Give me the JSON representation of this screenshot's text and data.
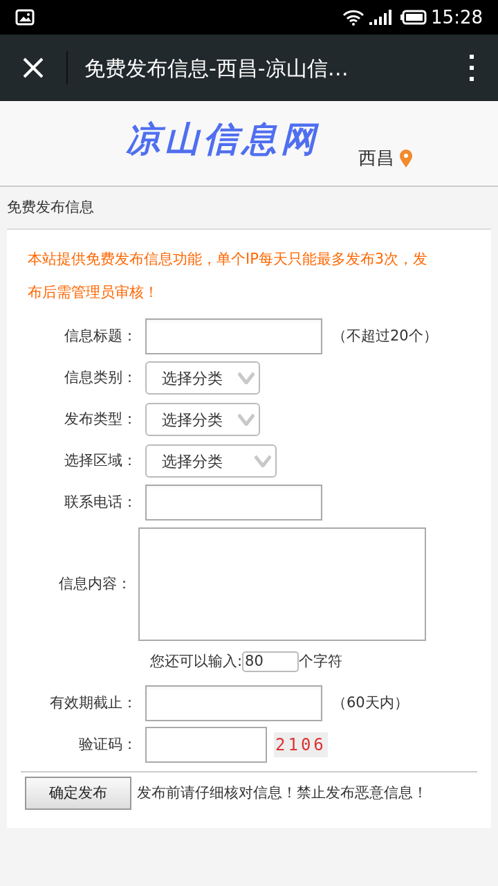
{
  "status_bar": {
    "time": "15:28"
  },
  "toolbar": {
    "title": "免费发布信息-西昌-凉山信…"
  },
  "header": {
    "logo": "凉山信息网",
    "city": "西昌"
  },
  "section_title": "免费发布信息",
  "notice": "本站提供免费发布信息功能，单个IP每天只能最多发布3次，发布后需管理员审核！",
  "fields": [
    {
      "kind": "text",
      "label": "信息标题：",
      "note": "（不超过20个）"
    },
    {
      "kind": "select",
      "label": "信息类别：",
      "value": "选择分类"
    },
    {
      "kind": "select",
      "label": "发布类型：",
      "value": "选择分类"
    },
    {
      "kind": "select",
      "label": "选择区域：",
      "value": "选择分类"
    },
    {
      "kind": "text",
      "label": "联系电话："
    },
    {
      "kind": "textarea",
      "label": "信息内容："
    },
    {
      "kind": "counter",
      "prefix": "您还可以输入:",
      "value": "80",
      "suffix": "个字符"
    },
    {
      "kind": "text",
      "label": "有效期截止：",
      "note": "（60天内）"
    },
    {
      "kind": "captcha",
      "label": "验证码：",
      "code": "2106"
    }
  ],
  "submit": {
    "label": "确定发布",
    "hint": "发布前请仔细核对信息！禁止发布恶意信息！"
  }
}
